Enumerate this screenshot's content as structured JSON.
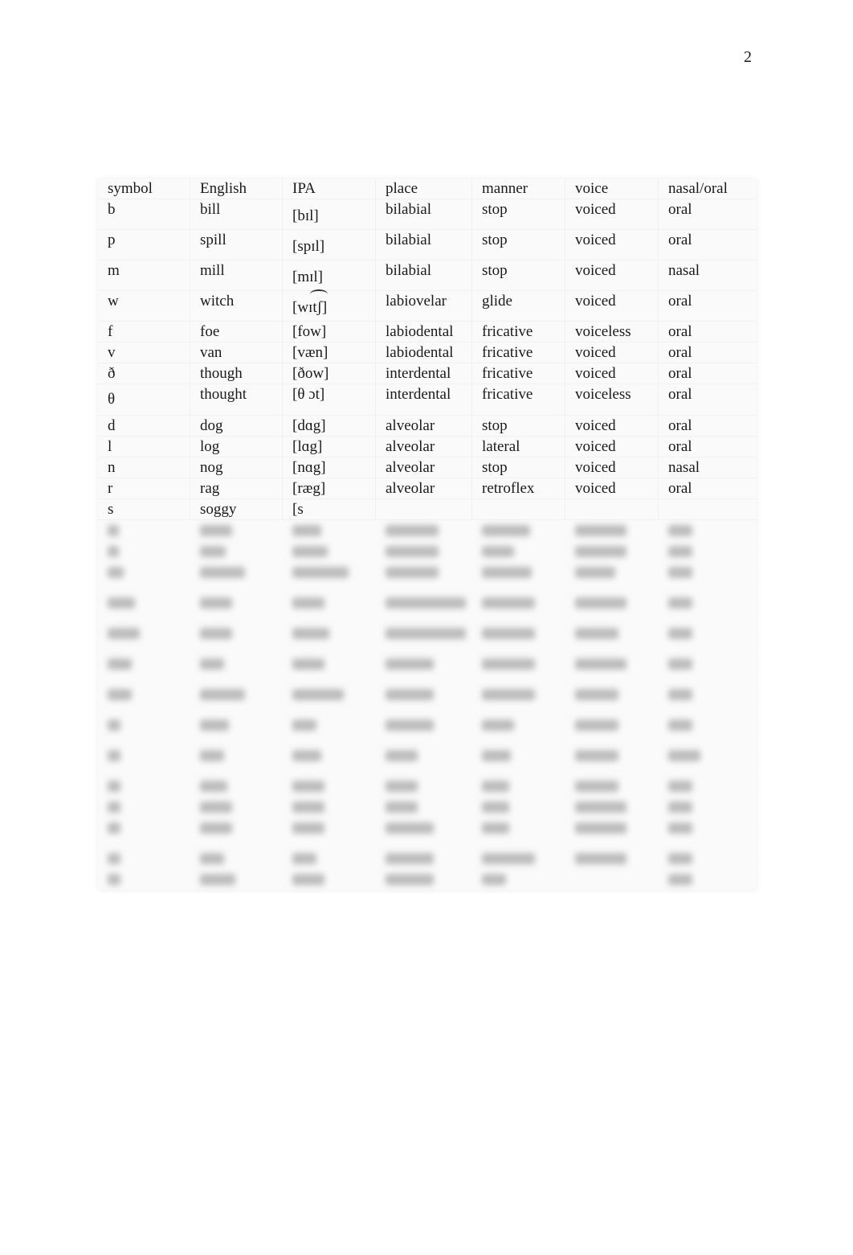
{
  "page": {
    "number": "2"
  },
  "table": {
    "headers": [
      "symbol",
      "English",
      "IPA",
      "place",
      "manner",
      "voice",
      "nasal/oral"
    ],
    "rows": [
      {
        "symbol": "b",
        "english": "bill",
        "ipa": "[bɪl]",
        "place": "bilabial",
        "manner": "stop",
        "voice": "voiced",
        "nasal_oral": "oral"
      },
      {
        "symbol": "p",
        "english": "spill",
        "ipa": "[spɪl]",
        "place": "bilabial",
        "manner": "stop",
        "voice": "voiced",
        "nasal_oral": "oral"
      },
      {
        "symbol": "m",
        "english": "mill",
        "ipa": "[mɪl]",
        "place": "bilabial",
        "manner": "stop",
        "voice": "voiced",
        "nasal_oral": "nasal"
      },
      {
        "symbol": "w",
        "english": "witch",
        "ipa": "[wɪtʃ]",
        "place": "labiovelar",
        "manner": "glide",
        "voice": "voiced",
        "nasal_oral": "oral"
      },
      {
        "symbol": "f",
        "english": "foe",
        "ipa": "[fow]",
        "place": "labiodental",
        "manner": "fricative",
        "voice": "voiceless",
        "nasal_oral": "oral"
      },
      {
        "symbol": "v",
        "english": "van",
        "ipa": "[væn]",
        "place": "labiodental",
        "manner": "fricative",
        "voice": "voiced",
        "nasal_oral": "oral"
      },
      {
        "symbol": "ð",
        "english": "though",
        "ipa": "[ðow]",
        "place": "interdental",
        "manner": "fricative",
        "voice": "voiced",
        "nasal_oral": "oral"
      },
      {
        "symbol": "θ",
        "english": "thought",
        "ipa": "[θ ɔt]",
        "place": "interdental",
        "manner": "fricative",
        "voice": "voiceless",
        "nasal_oral": "oral"
      },
      {
        "symbol": "d",
        "english": "dog",
        "ipa": "[dɑg]",
        "place": "alveolar",
        "manner": "stop",
        "voice": "voiced",
        "nasal_oral": "oral"
      },
      {
        "symbol": "l",
        "english": "log",
        "ipa": "[lɑg]",
        "place": "alveolar",
        "manner": "lateral",
        "voice": "voiced",
        "nasal_oral": "oral"
      },
      {
        "symbol": "n",
        "english": "nog",
        "ipa": "[nɑg]",
        "place": "alveolar",
        "manner": "stop",
        "voice": "voiced",
        "nasal_oral": "nasal"
      },
      {
        "symbol": "r",
        "english": "rag",
        "ipa": "[ræg]",
        "place": "alveolar",
        "manner": "retroflex",
        "voice": "voiced",
        "nasal_oral": "oral"
      },
      {
        "symbol": "s",
        "english": "soggy",
        "ipa": "[s",
        "place": "",
        "manner": "",
        "voice": "",
        "nasal_oral": ""
      }
    ]
  }
}
